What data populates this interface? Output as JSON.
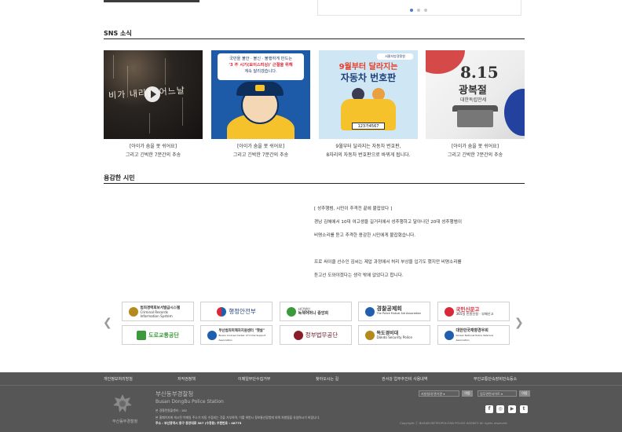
{
  "sns": {
    "title": "SNS 소식",
    "cards": [
      {
        "thumb_title": "비가 내리는 어느날",
        "line1": "[아이가 숨을 못 쉬어요]",
        "line2": "그리고 긴박한 7분간의 추송"
      },
      {
        "thumb_text1": "국민을 불안 · 불신 · 불행하게 만드는",
        "thumb_text2": "'3 不 시기(보이스피싱)' 근절을 위해",
        "thumb_text3": "계속 달리겠습니다.",
        "line1": "[아이가 숨을 못 쉬어요]",
        "line2": "그리고 긴박한 7분간의 추송"
      },
      {
        "thumb_tag": "서울지방경찰청",
        "thumb_head1": "9월부터 달라지는",
        "thumb_head2": "자동차 번호판",
        "thumb_plate": "123가4567",
        "line1": "9월부터 달라지는 자동차 번호판,",
        "line2": "8자리의 자동차 번호판으로 바뀌게 됩니다."
      },
      {
        "thumb_num": "8.15",
        "thumb_big": "광복절",
        "thumb_small": "대한독립만세",
        "line1": "[아이가 숨을 못 쉬어요]",
        "line2": "그리고 긴박한 7분간의 추송"
      }
    ]
  },
  "brave": {
    "title": "용감한 시민",
    "headline": "[ 성추행범, 시민이 추격전 끝에 붙잡았다 ]",
    "para1_line1": "경남 김해에서 10대 여고생을 길거리에서 성추행하고 달아나던 20대 성추행범이",
    "para1_line2": "비명소리를 듣고 추격한 용감한 시민에게 붙잡혔습니다.",
    "para2_line1": "프로 싸이클 선수인 김씨는 제압 과정에서 허리 부상을 입기도 했지만 비명소리를",
    "para2_line2": "듣고선 도와야겠다는 생각 밖에 없었다고 합니다."
  },
  "banners": [
    {
      "label": "범죄경력회보서발급시스템",
      "sub": "Criminal Records Information System",
      "color": "#b58a1c"
    },
    {
      "label": "행정안전부",
      "color": "#1f5fae"
    },
    {
      "label": "녹색어머니 중앙회",
      "sub": "사단법인",
      "color": "#3c9a3c"
    },
    {
      "label": "경찰공제회",
      "sub": "The Police Mutual Aid Association",
      "color": "#1f5fae"
    },
    {
      "label": "국민신문고",
      "sub": "365일 민원신청 · 부패신고",
      "color": "#d8283a"
    },
    {
      "label": "도로교통공단",
      "color": "#3c9a3c"
    },
    {
      "label": "부산범죄피해자지원센터 \"햇살\"",
      "sub": "Busan Counsel Center of Crime Support Association",
      "color": "#1f5fae"
    },
    {
      "label": "정부법무공단",
      "color": "#8a1c2a"
    },
    {
      "label": "독도경비대",
      "sub": "Dokdo Security Police",
      "color": "#b58a1c"
    },
    {
      "label": "대한민국재향경우회",
      "sub": "Korean National Police Veterans Association",
      "color": "#1f5fae"
    }
  ],
  "footer": {
    "links": [
      "개인정보처리방침",
      "저작권정책",
      "이메일무단수집거부",
      "찾아오시는 길",
      "권서강 업무추진비 사용내역",
      "무인교통단속장비민속등소"
    ],
    "org_ko": "부산동부경찰청",
    "org_en": "Busan DongBu Police Station",
    "emblem_name": "부산동부경찰청",
    "info1": "본 경찰민원콜센터 : 182",
    "info2": "본 홈페이지에 게시된 이메일 주소가 자동 수집되는 것을 거부하며, 이를 위반시 정보통신망법에 의해 처벌됨을 유념하시기 바랍니다.",
    "info3": "주소 : 부산광역시 동구 중앙대로 387 (수정동) 우편번호 : 48775",
    "select1": "지방청/유관기관",
    "select2": "업무관련사이트",
    "go_label": "이동",
    "copyright": "Copyright ⓒ BUSAN METROPOLITAN POLICE AGENCY All rights reserved.",
    "social": [
      "f",
      "◎",
      "▶",
      "t"
    ]
  },
  "colors": {
    "accent": "#4a7bd0",
    "footer_bg": "#565656"
  }
}
